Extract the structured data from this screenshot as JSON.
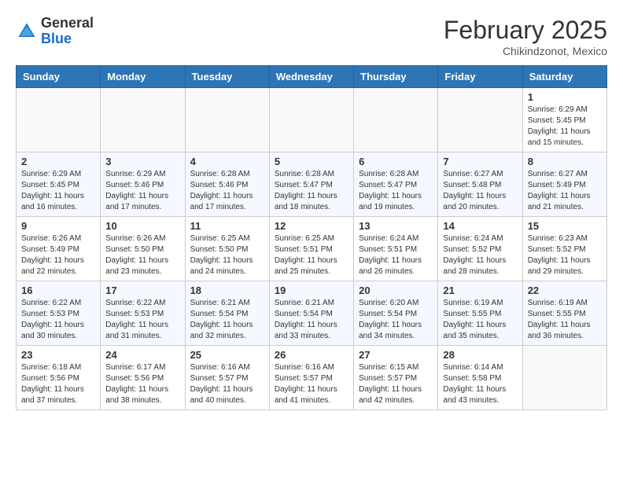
{
  "logo": {
    "general": "General",
    "blue": "Blue"
  },
  "header": {
    "month": "February 2025",
    "location": "Chikindzonot, Mexico"
  },
  "days_of_week": [
    "Sunday",
    "Monday",
    "Tuesday",
    "Wednesday",
    "Thursday",
    "Friday",
    "Saturday"
  ],
  "weeks": [
    [
      {
        "day": "",
        "info": ""
      },
      {
        "day": "",
        "info": ""
      },
      {
        "day": "",
        "info": ""
      },
      {
        "day": "",
        "info": ""
      },
      {
        "day": "",
        "info": ""
      },
      {
        "day": "",
        "info": ""
      },
      {
        "day": "1",
        "info": "Sunrise: 6:29 AM\nSunset: 5:45 PM\nDaylight: 11 hours\nand 15 minutes."
      }
    ],
    [
      {
        "day": "2",
        "info": "Sunrise: 6:29 AM\nSunset: 5:45 PM\nDaylight: 11 hours\nand 16 minutes."
      },
      {
        "day": "3",
        "info": "Sunrise: 6:29 AM\nSunset: 5:46 PM\nDaylight: 11 hours\nand 17 minutes."
      },
      {
        "day": "4",
        "info": "Sunrise: 6:28 AM\nSunset: 5:46 PM\nDaylight: 11 hours\nand 17 minutes."
      },
      {
        "day": "5",
        "info": "Sunrise: 6:28 AM\nSunset: 5:47 PM\nDaylight: 11 hours\nand 18 minutes."
      },
      {
        "day": "6",
        "info": "Sunrise: 6:28 AM\nSunset: 5:47 PM\nDaylight: 11 hours\nand 19 minutes."
      },
      {
        "day": "7",
        "info": "Sunrise: 6:27 AM\nSunset: 5:48 PM\nDaylight: 11 hours\nand 20 minutes."
      },
      {
        "day": "8",
        "info": "Sunrise: 6:27 AM\nSunset: 5:49 PM\nDaylight: 11 hours\nand 21 minutes."
      }
    ],
    [
      {
        "day": "9",
        "info": "Sunrise: 6:26 AM\nSunset: 5:49 PM\nDaylight: 11 hours\nand 22 minutes."
      },
      {
        "day": "10",
        "info": "Sunrise: 6:26 AM\nSunset: 5:50 PM\nDaylight: 11 hours\nand 23 minutes."
      },
      {
        "day": "11",
        "info": "Sunrise: 6:25 AM\nSunset: 5:50 PM\nDaylight: 11 hours\nand 24 minutes."
      },
      {
        "day": "12",
        "info": "Sunrise: 6:25 AM\nSunset: 5:51 PM\nDaylight: 11 hours\nand 25 minutes."
      },
      {
        "day": "13",
        "info": "Sunrise: 6:24 AM\nSunset: 5:51 PM\nDaylight: 11 hours\nand 26 minutes."
      },
      {
        "day": "14",
        "info": "Sunrise: 6:24 AM\nSunset: 5:52 PM\nDaylight: 11 hours\nand 28 minutes."
      },
      {
        "day": "15",
        "info": "Sunrise: 6:23 AM\nSunset: 5:52 PM\nDaylight: 11 hours\nand 29 minutes."
      }
    ],
    [
      {
        "day": "16",
        "info": "Sunrise: 6:22 AM\nSunset: 5:53 PM\nDaylight: 11 hours\nand 30 minutes."
      },
      {
        "day": "17",
        "info": "Sunrise: 6:22 AM\nSunset: 5:53 PM\nDaylight: 11 hours\nand 31 minutes."
      },
      {
        "day": "18",
        "info": "Sunrise: 6:21 AM\nSunset: 5:54 PM\nDaylight: 11 hours\nand 32 minutes."
      },
      {
        "day": "19",
        "info": "Sunrise: 6:21 AM\nSunset: 5:54 PM\nDaylight: 11 hours\nand 33 minutes."
      },
      {
        "day": "20",
        "info": "Sunrise: 6:20 AM\nSunset: 5:54 PM\nDaylight: 11 hours\nand 34 minutes."
      },
      {
        "day": "21",
        "info": "Sunrise: 6:19 AM\nSunset: 5:55 PM\nDaylight: 11 hours\nand 35 minutes."
      },
      {
        "day": "22",
        "info": "Sunrise: 6:19 AM\nSunset: 5:55 PM\nDaylight: 11 hours\nand 36 minutes."
      }
    ],
    [
      {
        "day": "23",
        "info": "Sunrise: 6:18 AM\nSunset: 5:56 PM\nDaylight: 11 hours\nand 37 minutes."
      },
      {
        "day": "24",
        "info": "Sunrise: 6:17 AM\nSunset: 5:56 PM\nDaylight: 11 hours\nand 38 minutes."
      },
      {
        "day": "25",
        "info": "Sunrise: 6:16 AM\nSunset: 5:57 PM\nDaylight: 11 hours\nand 40 minutes."
      },
      {
        "day": "26",
        "info": "Sunrise: 6:16 AM\nSunset: 5:57 PM\nDaylight: 11 hours\nand 41 minutes."
      },
      {
        "day": "27",
        "info": "Sunrise: 6:15 AM\nSunset: 5:57 PM\nDaylight: 11 hours\nand 42 minutes."
      },
      {
        "day": "28",
        "info": "Sunrise: 6:14 AM\nSunset: 5:58 PM\nDaylight: 11 hours\nand 43 minutes."
      },
      {
        "day": "",
        "info": ""
      }
    ]
  ]
}
